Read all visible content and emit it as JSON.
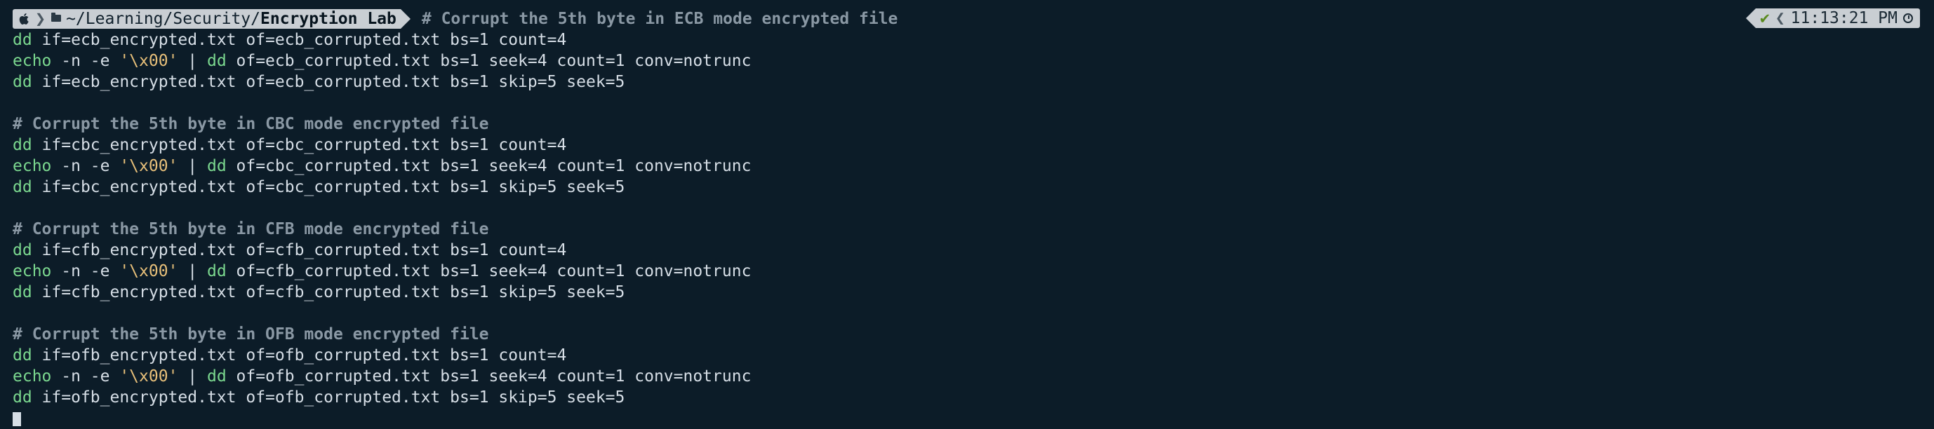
{
  "prompt": {
    "apple_icon": "apple-icon",
    "folder_icon": "folder-icon",
    "path_prefix": "~/Learning/Security/",
    "path_current": "Encryption Lab",
    "comment": "# Corrupt the 5th byte in ECB mode encrypted file"
  },
  "rprompt": {
    "check": "✔",
    "separator": "❮",
    "time": "11:13:21 PM",
    "clock_icon": "clock-icon"
  },
  "blocks": [
    {
      "comment": "",
      "lines": [
        {
          "cmd": "dd",
          "rest": " if=ecb_encrypted.txt of=ecb_corrupted.txt bs=1 count=4"
        },
        {
          "cmd": "echo",
          "pre": " -n -e ",
          "str": "'\\x00'",
          "pipe": " | ",
          "cmd2": "dd",
          "rest": " of=ecb_corrupted.txt bs=1 seek=4 count=1 conv=notrunc"
        },
        {
          "cmd": "dd",
          "rest": " if=ecb_encrypted.txt of=ecb_corrupted.txt bs=1 skip=5 seek=5"
        }
      ]
    },
    {
      "comment": "# Corrupt the 5th byte in CBC mode encrypted file",
      "lines": [
        {
          "cmd": "dd",
          "rest": " if=cbc_encrypted.txt of=cbc_corrupted.txt bs=1 count=4"
        },
        {
          "cmd": "echo",
          "pre": " -n -e ",
          "str": "'\\x00'",
          "pipe": " | ",
          "cmd2": "dd",
          "rest": " of=cbc_corrupted.txt bs=1 seek=4 count=1 conv=notrunc"
        },
        {
          "cmd": "dd",
          "rest": " if=cbc_encrypted.txt of=cbc_corrupted.txt bs=1 skip=5 seek=5"
        }
      ]
    },
    {
      "comment": "# Corrupt the 5th byte in CFB mode encrypted file",
      "lines": [
        {
          "cmd": "dd",
          "rest": " if=cfb_encrypted.txt of=cfb_corrupted.txt bs=1 count=4"
        },
        {
          "cmd": "echo",
          "pre": " -n -e ",
          "str": "'\\x00'",
          "pipe": " | ",
          "cmd2": "dd",
          "rest": " of=cfb_corrupted.txt bs=1 seek=4 count=1 conv=notrunc"
        },
        {
          "cmd": "dd",
          "rest": " if=cfb_encrypted.txt of=cfb_corrupted.txt bs=1 skip=5 seek=5"
        }
      ]
    },
    {
      "comment": "# Corrupt the 5th byte in OFB mode encrypted file",
      "lines": [
        {
          "cmd": "dd",
          "rest": " if=ofb_encrypted.txt of=ofb_corrupted.txt bs=1 count=4"
        },
        {
          "cmd": "echo",
          "pre": " -n -e ",
          "str": "'\\x00'",
          "pipe": " | ",
          "cmd2": "dd",
          "rest": " of=ofb_corrupted.txt bs=1 seek=4 count=1 conv=notrunc"
        },
        {
          "cmd": "dd",
          "rest": " if=ofb_encrypted.txt of=ofb_corrupted.txt bs=1 skip=5 seek=5"
        }
      ]
    }
  ],
  "colors": {
    "background": "#0c1c28",
    "command": "#7bd88f",
    "string": "#e8c07a",
    "comment": "#8a98a4",
    "prompt_bg": "#c9ced3"
  }
}
